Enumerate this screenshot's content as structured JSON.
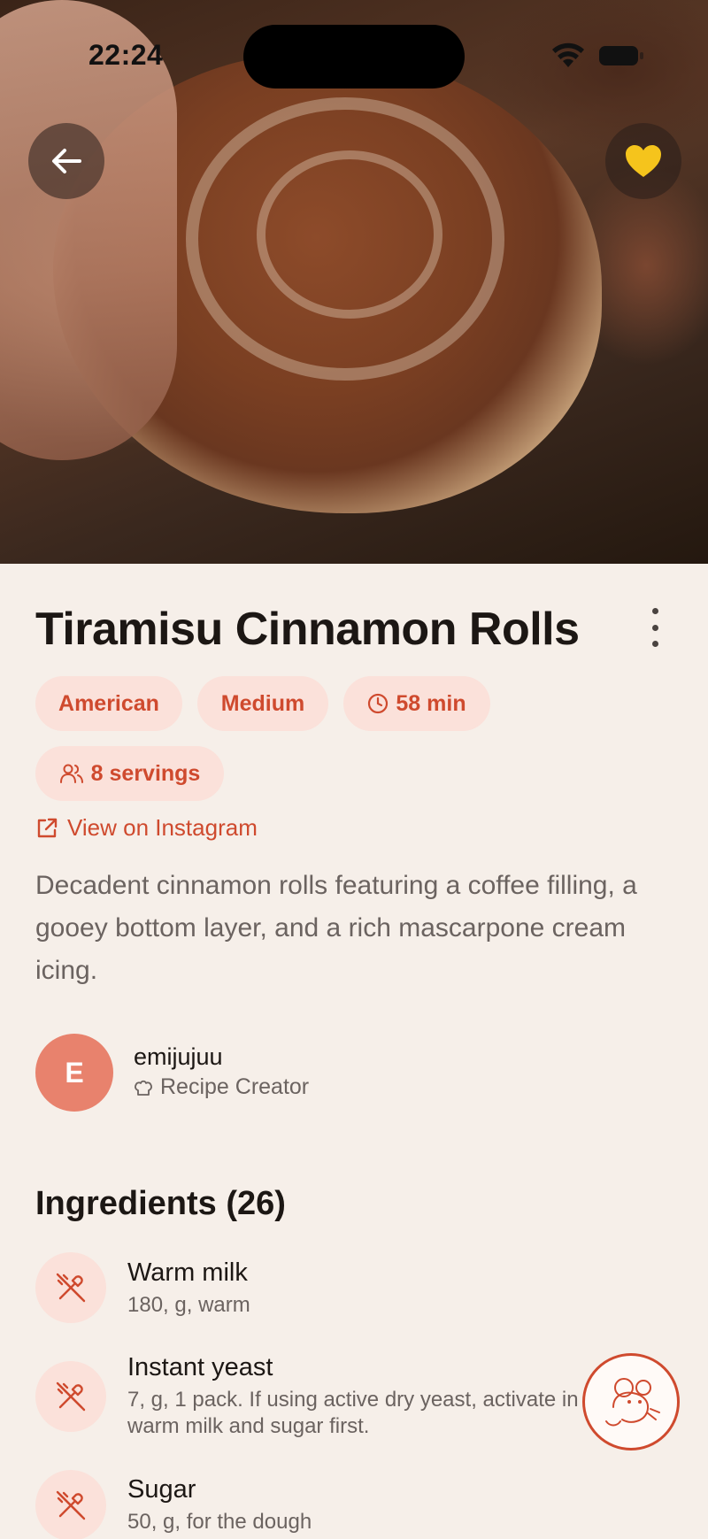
{
  "status_bar": {
    "time": "22:24"
  },
  "header": {
    "back_icon": "arrow-left-icon",
    "favorite_icon": "heart-icon",
    "favorite_color": "#f5c41c"
  },
  "recipe": {
    "title": "Tiramisu Cinnamon Rolls",
    "chips": {
      "cuisine": "American",
      "difficulty": "Medium",
      "time": "58 min",
      "servings": "8 servings"
    },
    "source_link": "View on Instagram",
    "description": "Decadent cinnamon rolls featuring a coffee filling, a gooey bottom layer, and a rich mascarpone cream icing."
  },
  "creator": {
    "initial": "E",
    "name": "emijujuu",
    "role": "Recipe Creator"
  },
  "ingredients": {
    "heading": "Ingredients (26)",
    "items": [
      {
        "name": "Warm milk",
        "detail": "180, g, warm"
      },
      {
        "name": "Instant yeast",
        "detail": "7, g, 1 pack. If using active dry yeast, activate in warm milk and sugar first."
      },
      {
        "name": "Sugar",
        "detail": "50, g, for the dough"
      }
    ]
  },
  "colors": {
    "accent": "#cf4a2e",
    "chip_bg": "#fbe1da",
    "background": "#f6efe9",
    "avatar": "#e8826d"
  }
}
